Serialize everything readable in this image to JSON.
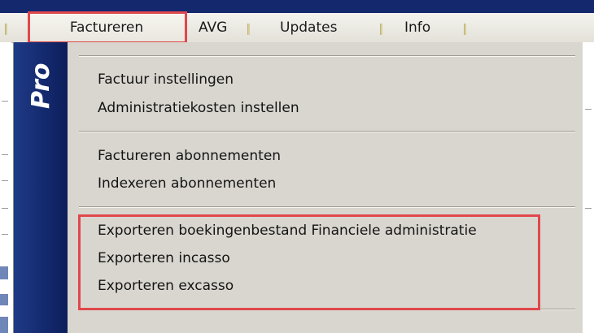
{
  "menubar": {
    "items": [
      {
        "label": "Factureren"
      },
      {
        "label": "AVG"
      },
      {
        "label": "Updates"
      },
      {
        "label": "Info"
      }
    ]
  },
  "dropdown": {
    "badge": "Pro",
    "groups": [
      {
        "items": [
          "Factuur instellingen",
          "Administratiekosten instellen"
        ]
      },
      {
        "items": [
          "Factureren abonnementen",
          "Indexeren abonnementen"
        ]
      },
      {
        "items": [
          "Exporteren boekingenbestand Financiele administratie",
          "Exporteren incasso",
          "Exporteren excasso"
        ]
      }
    ]
  },
  "colors": {
    "highlight": "#e0474c",
    "pro_strip": "#13296d",
    "menu_bg": "#d9d6cf"
  }
}
